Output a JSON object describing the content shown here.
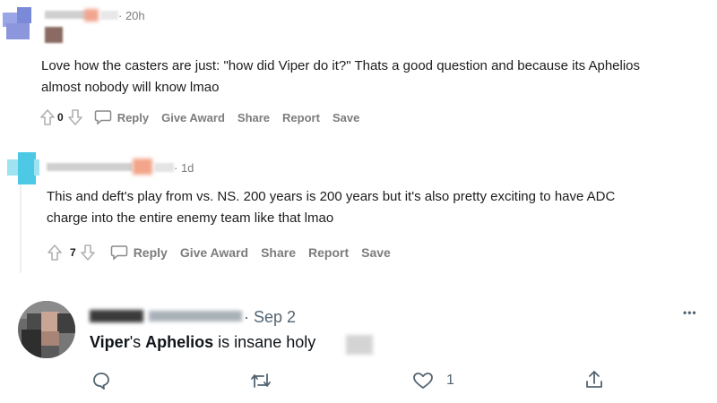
{
  "comments": [
    {
      "time": "20h",
      "body_lines": [
        "Love how the casters are just: \"how did Viper do it?\" Thats a good question and because its Aphelios",
        "almost nobody will know lmao"
      ],
      "votes": "0",
      "actions": {
        "reply": "Reply",
        "give_award": "Give Award",
        "share": "Share",
        "report": "Report",
        "save": "Save"
      }
    },
    {
      "time": "1d",
      "body_lines": [
        "This and deft's play from vs. NS. 200 years is 200 years but it's also pretty exciting to have ADC",
        "charge into the entire enemy team like that lmao"
      ],
      "votes": "7",
      "actions": {
        "reply": "Reply",
        "give_award": "Give Award",
        "share": "Share",
        "report": "Report",
        "save": "Save"
      }
    }
  ],
  "tweet": {
    "date": "Sep 2",
    "text_parts": {
      "name1": "Viper",
      "s": "'s ",
      "name2": "Aphelios",
      "rest": " is insane holy"
    },
    "likes": "1",
    "more": "•••"
  },
  "icons": {
    "upvote": "upvote-arrow-icon",
    "downvote": "downvote-arrow-icon",
    "reply": "speech-bubble-icon",
    "tw_reply": "comment-bubble-icon",
    "tw_retweet": "retweet-icon",
    "tw_like": "heart-icon",
    "tw_share": "share-upload-icon"
  },
  "colors": {
    "action_text": "#7c7c7c",
    "body_text": "#1c1c1c",
    "tweet_meta": "#536471",
    "tweet_text": "#0f1419"
  }
}
